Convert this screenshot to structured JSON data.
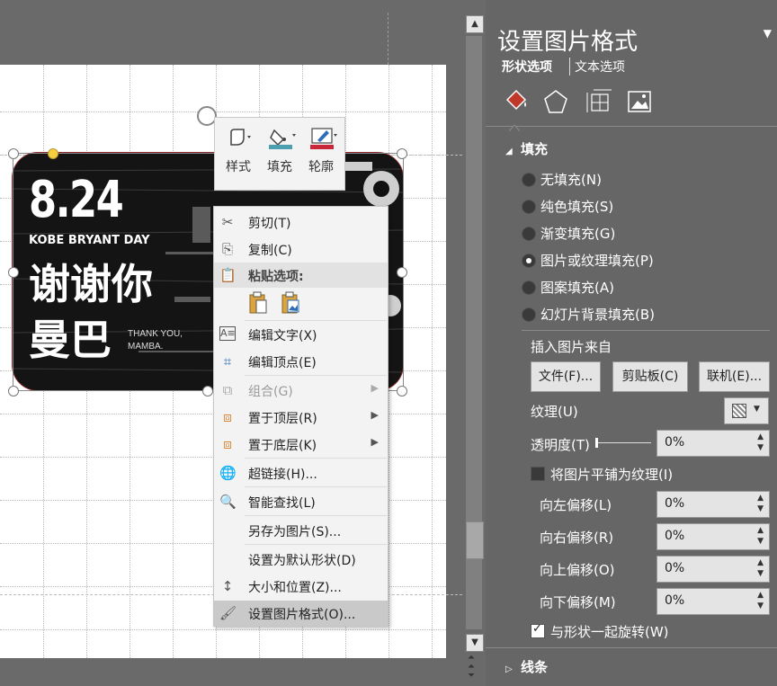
{
  "picture": {
    "date": "8.24",
    "subtitle": "KOBE BRYANT DAY",
    "line1": "谢谢你",
    "line2": "曼巴",
    "thanks": "THANK YOU,",
    "mamba": "MAMBA."
  },
  "mini_toolbar": {
    "style_label": "样式",
    "fill_label": "填充",
    "outline_label": "轮廓",
    "fill_color": "#4aa0b0",
    "outline_color": "#c8283a"
  },
  "context_menu": {
    "cut": "剪切(T)",
    "copy": "复制(C)",
    "paste_options": "粘贴选项:",
    "edit_text": "编辑文字(X)",
    "edit_points": "编辑顶点(E)",
    "group": "组合(G)",
    "bring_front": "置于顶层(R)",
    "send_back": "置于底层(K)",
    "hyperlink": "超链接(H)...",
    "smart_lookup": "智能查找(L)",
    "save_as_picture": "另存为图片(S)...",
    "set_default_shape": "设置为默认形状(D)",
    "size_position": "大小和位置(Z)...",
    "format_picture": "设置图片格式(O)..."
  },
  "pane": {
    "title": "设置图片格式",
    "tab_shape": "形状选项",
    "tab_text": "文本选项",
    "section_fill": "填充",
    "fill_options": [
      {
        "label": "无填充(N)",
        "selected": false
      },
      {
        "label": "纯色填充(S)",
        "selected": false
      },
      {
        "label": "渐变填充(G)",
        "selected": false
      },
      {
        "label": "图片或纹理填充(P)",
        "selected": true
      },
      {
        "label": "图案填充(A)",
        "selected": false
      },
      {
        "label": "幻灯片背景填充(B)",
        "selected": false
      }
    ],
    "insert_from": "插入图片来自",
    "btn_file": "文件(F)...",
    "btn_clipboard": "剪贴板(C)",
    "btn_online": "联机(E)...",
    "texture_label": "纹理(U)",
    "transparency_label": "透明度(T)",
    "transparency_value": "0%",
    "tile_label": "将图片平铺为纹理(I)",
    "tile_checked": false,
    "offset_left_label": "向左偏移(L)",
    "offset_left_value": "0%",
    "offset_right_label": "向右偏移(R)",
    "offset_right_value": "0%",
    "offset_up_label": "向上偏移(O)",
    "offset_up_value": "0%",
    "offset_down_label": "向下偏移(M)",
    "offset_down_value": "0%",
    "rotate_label": "与形状一起旋转(W)",
    "rotate_checked": true,
    "section_line": "线条"
  },
  "colors": {
    "accent": "#c0392b",
    "pane_bg": "#666666",
    "canvas_bg": "#6a6a6a"
  }
}
